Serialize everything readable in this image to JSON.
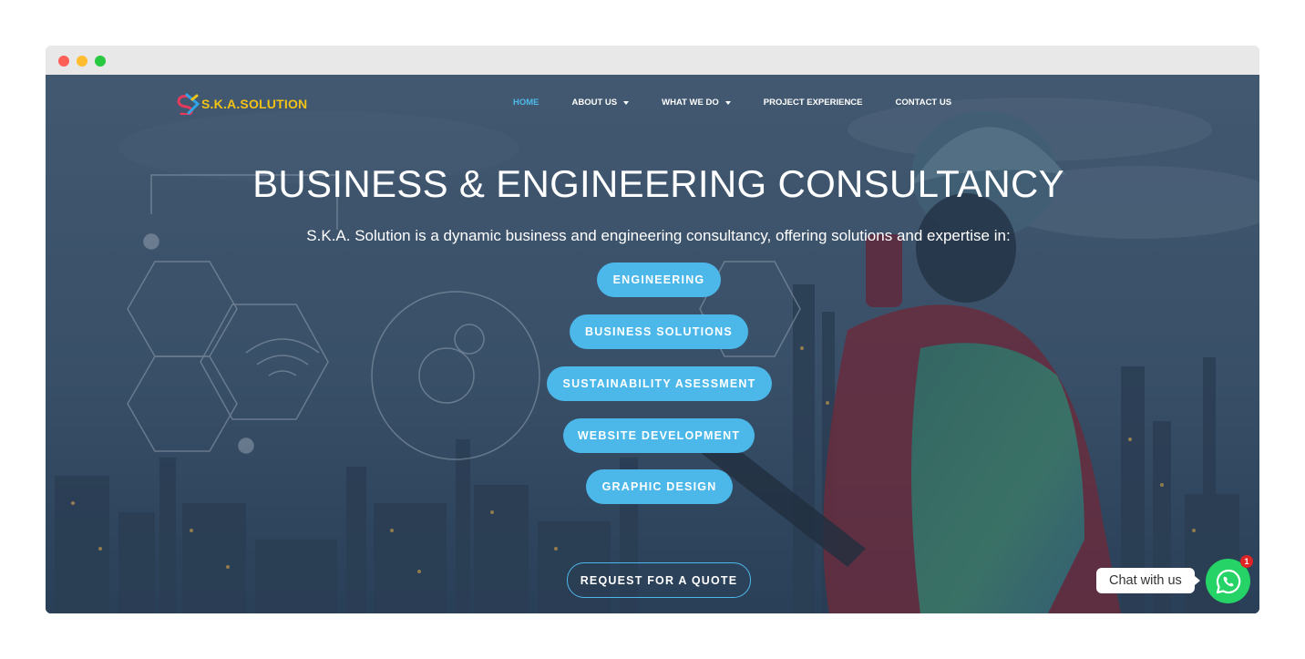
{
  "brand": {
    "name": "S.K.A.SOLUTION",
    "logo_color": "#f2c316"
  },
  "nav": {
    "items": [
      {
        "label": "HOME",
        "active": true,
        "dropdown": false
      },
      {
        "label": "ABOUT US",
        "active": false,
        "dropdown": true
      },
      {
        "label": "WHAT WE DO",
        "active": false,
        "dropdown": true
      },
      {
        "label": "PROJECT EXPERIENCE",
        "active": false,
        "dropdown": false
      },
      {
        "label": "CONTACT US",
        "active": false,
        "dropdown": false
      }
    ],
    "active_color": "#4fb9ea"
  },
  "hero": {
    "title": "BUSINESS & ENGINEERING CONSULTANCY",
    "subtitle": "S.K.A. Solution is a dynamic business and engineering consultancy, offering solutions and expertise in:",
    "services": [
      "ENGINEERING",
      "BUSINESS SOLUTIONS",
      "SUSTAINABILITY ASESSMENT",
      "WEBSITE DEVELOPMENT",
      "GRAPHIC DESIGN"
    ],
    "cta_label": "REQUEST FOR A QUOTE",
    "accent_color": "#4cb8ea"
  },
  "chat": {
    "label": "Chat with us",
    "badge_count": "1",
    "icon": "whatsapp-icon",
    "color": "#25d366"
  }
}
